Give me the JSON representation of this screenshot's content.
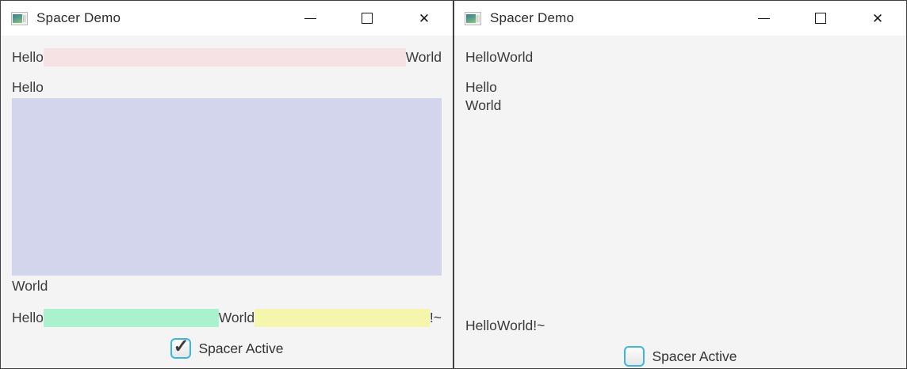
{
  "colors": {
    "titlebar_bg": "#ffffff",
    "body_bg": "#f4f4f4",
    "pink_spacer": "#f6e1e4",
    "lavender_spacer": "#d3d5ed",
    "green_spacer": "#aaf2cd",
    "yellow_spacer": "#f5f6ab",
    "checkbox_accent": "#3cb5e5"
  },
  "icons": {
    "close_glyph": "✕",
    "check_glyph": "✓"
  },
  "left_window": {
    "title": "Spacer Demo",
    "row1": {
      "hello": "Hello",
      "world": "World"
    },
    "col": {
      "hello": "Hello",
      "world": "World"
    },
    "row3": {
      "hello": "Hello",
      "world": "World",
      "suffix": "!~"
    },
    "checkbox": {
      "label": "Spacer Active",
      "checked": true
    }
  },
  "right_window": {
    "title": "Spacer Demo",
    "row1": {
      "hello": "Hello",
      "world": "World"
    },
    "col": {
      "hello": "Hello",
      "world": "World"
    },
    "row3": {
      "hello": "Hello",
      "world": "World",
      "suffix": "!~"
    },
    "checkbox": {
      "label": "Spacer Active",
      "checked": false
    }
  }
}
